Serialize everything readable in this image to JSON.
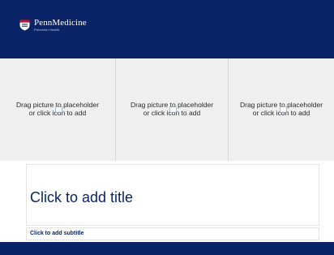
{
  "brand": {
    "name": "PennMedicine",
    "subtitle": "Princeton Health"
  },
  "placeholders": [
    {
      "label": "Drag picture to placeholder\nor click icon to add"
    },
    {
      "label": "Drag picture to placeholder\nor click icon to add"
    },
    {
      "label": "Drag picture to placeholder\nor click icon to add"
    }
  ],
  "slide": {
    "title_placeholder": "Click to add title",
    "subtitle_placeholder": "Click to add subtitle"
  },
  "colors": {
    "brand_navy": "#0b2468",
    "placeholder_gray": "#efefef"
  },
  "icons": {
    "logo": "penn-shield-icon",
    "picture": "insert-picture-icon"
  }
}
